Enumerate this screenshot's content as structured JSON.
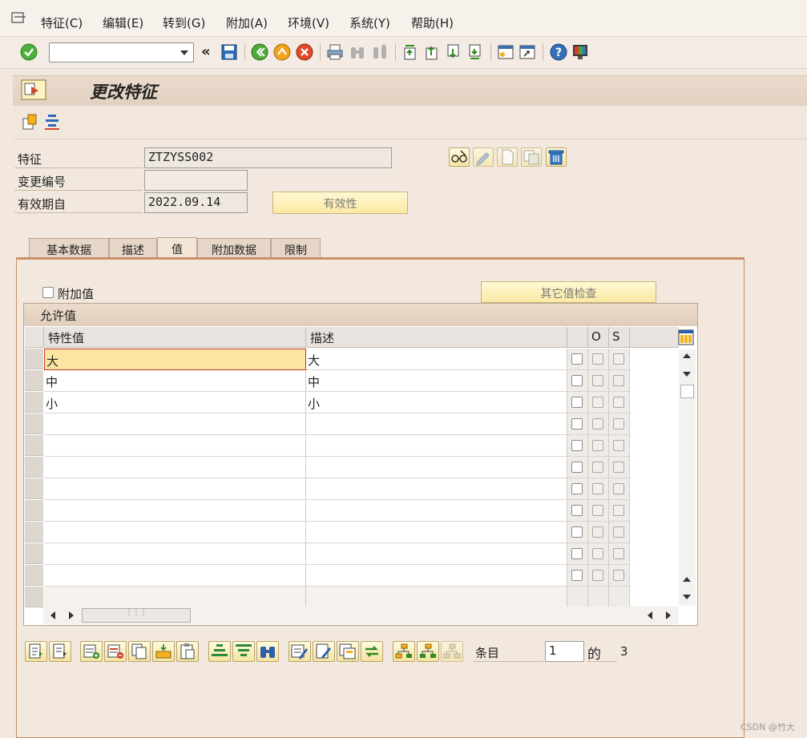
{
  "menu": {
    "items": [
      {
        "label": "特征(C)"
      },
      {
        "label": "编辑(E)"
      },
      {
        "label": "转到(G)"
      },
      {
        "label": "附加(A)"
      },
      {
        "label": "环境(V)"
      },
      {
        "label": "系统(Y)"
      },
      {
        "label": "帮助(H)"
      }
    ]
  },
  "toolbar": {
    "command_value": "",
    "back_label": "«"
  },
  "title": "更改特征",
  "header": {
    "characteristic_label": "特征",
    "characteristic_value": "ZTZYSS002",
    "change_number_label": "变更编号",
    "change_number_value": "",
    "valid_from_label": "有效期自",
    "valid_from_value": "2022.09.14",
    "validity_button": "有效性"
  },
  "tabs": [
    {
      "label": "基本数据"
    },
    {
      "label": "描述"
    },
    {
      "label": "值"
    },
    {
      "label": "附加数据"
    },
    {
      "label": "限制"
    }
  ],
  "values_tab": {
    "additional_values_label": "附加值",
    "other_value_check_button": "其它值检查",
    "table_title": "允许值",
    "columns": {
      "value": "特性值",
      "description": "描述",
      "o": "O",
      "s": "S"
    },
    "rows": [
      {
        "value": "大",
        "description": "大"
      },
      {
        "value": "中",
        "description": "中"
      },
      {
        "value": "小",
        "description": "小"
      }
    ]
  },
  "footer": {
    "entry_label": "条目",
    "entry_value": "1",
    "of_label": "的",
    "total": "3"
  },
  "watermark": "CSDN @竹大",
  "colors": {
    "accent": "#c9906a",
    "selected_cell": "#fbe5a0",
    "button_yellow": "#fbe9a4"
  }
}
